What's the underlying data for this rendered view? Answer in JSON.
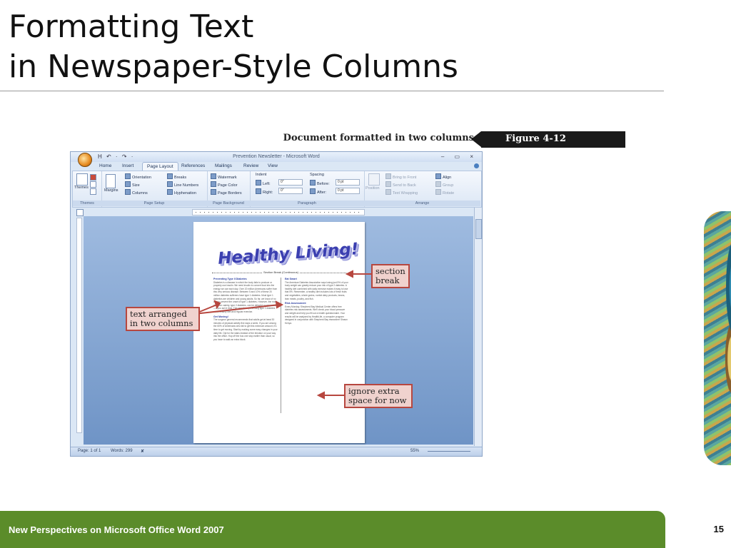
{
  "slide": {
    "title_line1": "Formatting Text",
    "title_line2": "in Newspaper-Style Columns",
    "footer": "New Perspectives on Microsoft Office Word 2007",
    "page_number": "15"
  },
  "figure": {
    "caption": "Document formatted in two columns",
    "label": "Figure 4-12"
  },
  "word": {
    "title": "Prevention Newsletter - Microsoft Word",
    "qat": "H ↶ · ↷ ·",
    "window_controls": "– ▭ ×",
    "tabs": [
      "Home",
      "Insert",
      "Page Layout",
      "References",
      "Mailings",
      "Review",
      "View"
    ],
    "active_tab": "Page Layout",
    "ribbon": {
      "themes_group": "Themes",
      "themes_btn": "Themes",
      "margins_btn": "Margins",
      "page_setup_group": "Page Setup",
      "orientation": "Orientation",
      "size": "Size",
      "columns": "Columns",
      "breaks": "Breaks",
      "line_numbers": "Line Numbers",
      "hyphenation": "Hyphenation",
      "page_background_group": "Page Background",
      "watermark": "Watermark",
      "page_color": "Page Color",
      "page_borders": "Page Borders",
      "paragraph_group": "Paragraph",
      "indent": "Indent",
      "left": "Left:",
      "right": "Right:",
      "left_value": "0\"",
      "right_value": "0\"",
      "spacing": "Spacing",
      "before": "Before:",
      "after": "After:",
      "before_value": "0 pt",
      "after_value": "0 pt",
      "arrange_group": "Arrange",
      "position": "Position",
      "bring_to_front": "Bring to Front",
      "send_to_back": "Send to Back",
      "text_wrapping": "Text Wrapping",
      "align": "Align",
      "group": "Group",
      "rotate": "Rotate"
    },
    "status": {
      "page": "Page: 1 of 1",
      "words": "Words: 299",
      "zoom": "55%"
    }
  },
  "document": {
    "banner": "Healthy Living!",
    "section_break": "Section Break (Continuous)",
    "left_col_heading1": "Preventing Type II Diabetes",
    "left_col_p1": "Diabetes is a disease in which the body fails to produce or properly use insulin. We need insulin to convert food into the energy we use each day. Over 20 million Americans suffer from this very serious disease. Between 5 and 10% of these 20 million diabetes sufferers have type 1 diabetes. Most type 1 diabetics are children and young adults. So far, we know of no way to prevent the onset of type 1 diabetes. However, the more common variety, type 2 diabetes, can be delayed or prevented—if you act in time. The secrets to preventing type 2 diabetes are a healthy diet and regular exercise.",
    "left_col_heading2": "Get Moving!",
    "left_col_p2": "The surgeon general recommends that adults get at least 30 minutes of physical activity five days a week. If you are among the 60% of Americans who fail to get this minimum amount, it's time to get moving. Start by making some easy changes in your daily life. Opt for the stairs instead of the elevator on your way into the office. Hop off the bus one stop earlier than usual, so you have to walk an extra block.",
    "right_col_heading1": "Eat Smart",
    "right_col_p1": "The American Diabetes Association says losing just 5% of your body weight can greatly reduce your risk of type 2 diabetes. A healthy diet combined with daily exercise makes it easy to lose that 5%. Remember, a healthy diet includes lots of fresh fruits and vegetables, whole grains, nonfat dairy products, beans, lean meats, poultry, and fish.",
    "right_col_heading2": "Risk Assessment",
    "right_col_p2": "Every Monday, Shepherd Bay Medical Center offers free diabetes risk assessments. We'll check your blood pressure and weight and help you fill out a health questionnaire. Your results will be analyzed by HealthLife, a computer program designed in conjunction with Shepherd Bay researcher Shawn Kenya."
  },
  "callouts": {
    "section_break": "section break",
    "text_arranged": "text arranged in two columns",
    "ignore_space": "ignore extra space for now"
  },
  "colors": {
    "footer_green": "#5b8c2a",
    "callout_border": "#b7473f",
    "callout_fill": "#f0d2ce",
    "banner_blue": "#3b3fb0"
  }
}
